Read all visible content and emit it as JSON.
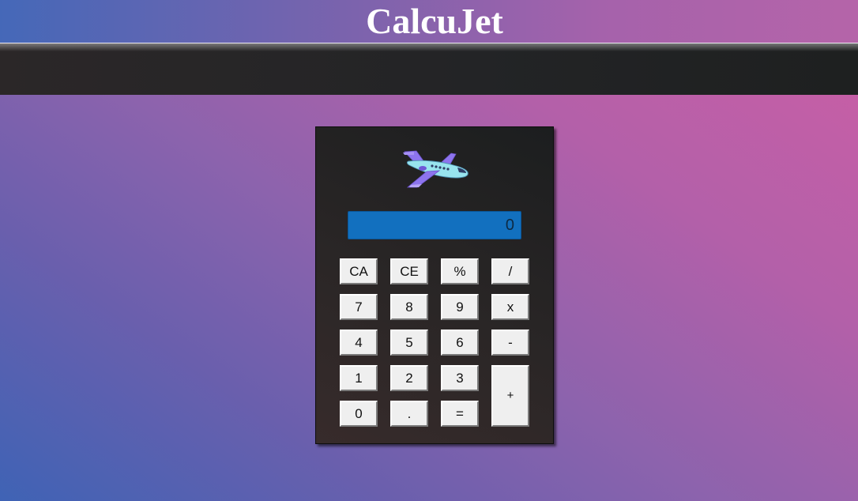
{
  "header": {
    "title": "CalcuJet"
  },
  "calculator": {
    "logo_icon": "airplane-icon",
    "display_value": "0",
    "keys": {
      "ca": "CA",
      "ce": "CE",
      "percent": "%",
      "divide": "/",
      "seven": "7",
      "eight": "8",
      "nine": "9",
      "multiply": "x",
      "four": "4",
      "five": "5",
      "six": "6",
      "minus": "-",
      "one": "1",
      "two": "2",
      "three": "3",
      "plus": "+",
      "zero": "0",
      "decimal": ".",
      "equals": "="
    }
  },
  "colors": {
    "display_background": "#1270bf",
    "navbar": "#232426",
    "calculator_body": "#2a2626",
    "key_face": "#efefef",
    "background_start": "#3f63b5",
    "background_end": "#cc5ea5"
  }
}
